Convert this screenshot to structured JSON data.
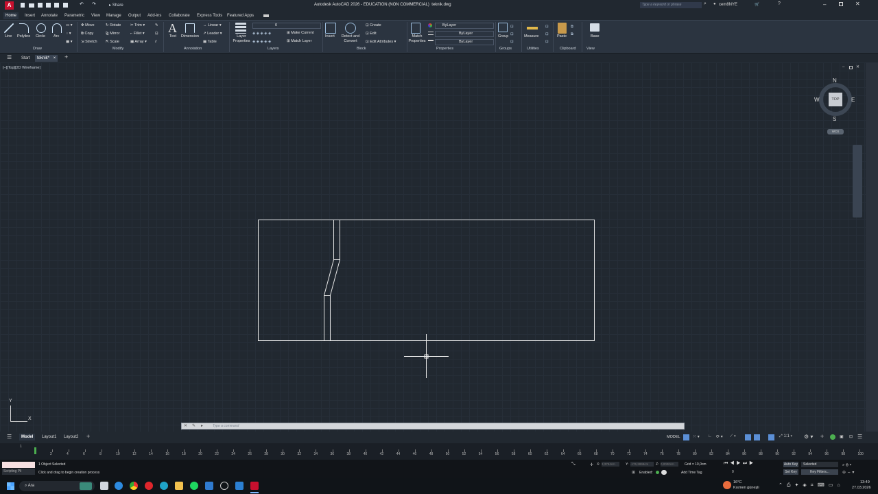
{
  "titlebar": {
    "app_title": "Autodesk AutoCAD 2026 - EDUCATION (NON COMMERCIAL)",
    "file_name": "teknik.dwg",
    "share_label": "Share",
    "search_placeholder": "Type a keyword or phrase",
    "user_name": "cem8NYE",
    "app_letter": "A"
  },
  "ribbon_tabs": [
    "Home",
    "Insert",
    "Annotate",
    "Parametric",
    "View",
    "Manage",
    "Output",
    "Add-ins",
    "Collaborate",
    "Express Tools",
    "Featured Apps"
  ],
  "ribbon": {
    "draw": {
      "line": "Line",
      "polyline": "Polyline",
      "circle": "Circle",
      "arc": "Arc",
      "label": "Draw"
    },
    "modify": {
      "move": "Move",
      "rotate": "Rotate",
      "trim": "Trim",
      "copy": "Copy",
      "mirror": "Mirror",
      "fillet": "Fillet",
      "stretch": "Stretch",
      "scale": "Scale",
      "array": "Array",
      "label": "Modify"
    },
    "annotation": {
      "text": "Text",
      "dimension": "Dimension",
      "linear": "Linear",
      "leader": "Leader",
      "table": "Table",
      "label": "Annotation"
    },
    "layers": {
      "layer_properties": "Layer Properties",
      "make_current": "Make Current",
      "match_layer": "Match Layer",
      "current_layer": "0",
      "label": "Layers"
    },
    "block": {
      "insert": "Insert",
      "detect_convert": "Detect and Convert",
      "create": "Create",
      "edit": "Edit",
      "edit_attributes": "Edit Attributes",
      "label": "Block"
    },
    "properties": {
      "match_properties": "Match Properties",
      "color": "ByLayer",
      "linetype": "ByLayer",
      "lineweight": "ByLayer",
      "label": "Properties"
    },
    "groups": {
      "group": "Group",
      "label": "Groups"
    },
    "utilities": {
      "measure": "Measure",
      "label": "Utilities"
    },
    "clipboard": {
      "paste": "Paste",
      "label": "Clipboard"
    },
    "view": {
      "base": "Base",
      "label": "View"
    }
  },
  "filetabs": {
    "start": "Start",
    "active_file": "teknik*"
  },
  "viewport": {
    "view_label": "[–][Top][2D Wireframe]",
    "compass": {
      "n": "N",
      "s": "S",
      "e": "E",
      "w": "W",
      "top": "TOP",
      "wcs": "WCS"
    },
    "ucs": {
      "x": "X",
      "y": "Y"
    }
  },
  "command_line": {
    "placeholder": "Type a command"
  },
  "layout_tabs": [
    "Model",
    "Layout1",
    "Layout2"
  ],
  "statusbar_model": "MODEL",
  "timeline": {
    "ticks": [
      "2",
      "4",
      "6",
      "8",
      "10",
      "12",
      "14",
      "16",
      "18",
      "20",
      "22",
      "24",
      "26",
      "28",
      "30",
      "32",
      "34",
      "36",
      "38",
      "40",
      "42",
      "44",
      "46",
      "48",
      "50",
      "52",
      "54",
      "56",
      "58",
      "60",
      "62",
      "64",
      "66",
      "68",
      "70",
      "72",
      "74",
      "76",
      "78",
      "80",
      "82",
      "84",
      "86",
      "88",
      "90",
      "92",
      "94",
      "96",
      "98",
      "100"
    ],
    "marker": "1"
  },
  "status": {
    "selection": "1 Object Selected",
    "hint": "Click and drag to begin creation process",
    "scripting": "Scripting Pli",
    "x_label": "X:",
    "x_value": "3,3794cm",
    "y_label": "Y:",
    "y_value": "-176,2898cm",
    "z_label": "Z:",
    "z_value": "0,0000cm",
    "grid": "Grid = 10,0cm",
    "enabled": "Enabled:",
    "add_time_tag": "Add Time Tag",
    "auto_key": "Auto Key",
    "set_key": "Set Key",
    "selected": "Selected",
    "key_filters": "Key Filters...",
    "frame": "0"
  },
  "taskbar": {
    "search": "Ara",
    "weather_temp": "16°C",
    "weather_desc": "Kısmen güneşli",
    "time": "13:49",
    "date": "27.03.2026"
  }
}
